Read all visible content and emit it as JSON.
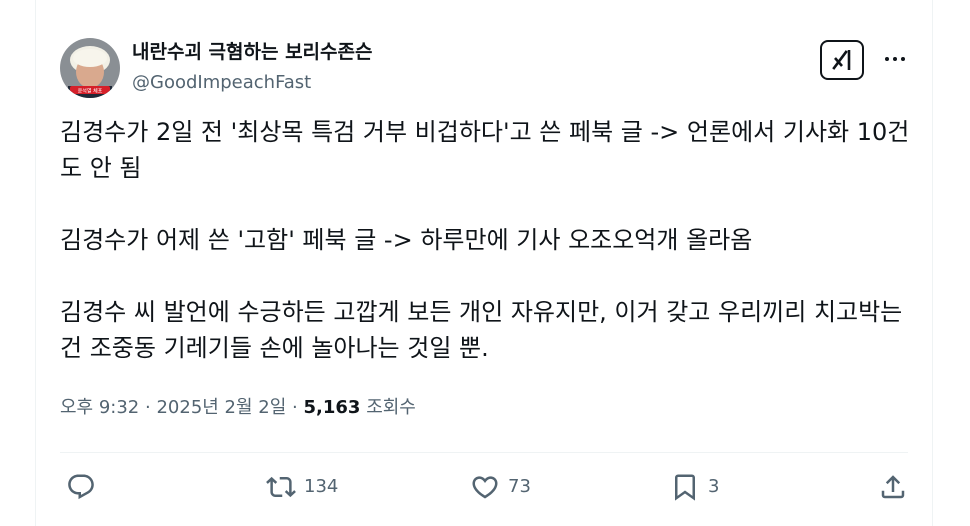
{
  "author": {
    "display_name": "내란수괴 극혐하는 보리수존슨",
    "handle": "@GoodImpeachFast",
    "avatar_badge": "윤석열 체포"
  },
  "tweet": {
    "paragraphs": [
      "김경수가 2일 전 '최상목 특검 거부 비겁하다'고 쓴 페북 글 -> 언론에서 기사화 10건 도 안 됨",
      "김경수가 어제 쓴 '고함' 페북 글 -> 하루만에 기사 오조오억개 올라옴",
      "김경수 씨 발언에 수긍하든 고깝게 보든 개인 자유지만, 이거 갖고 우리끼리 치고박는건 조중동 기레기들 손에 놀아나는 것일 뿐."
    ],
    "time": "오후 9:32",
    "separator": "·",
    "date": "2025년 2월 2일",
    "views_count": "5,163",
    "views_label": "조회수"
  },
  "actions": {
    "reply_count": "",
    "retweet_count": "134",
    "like_count": "73",
    "bookmark_count": "3"
  },
  "icons": {
    "grok": "grok-icon",
    "more": "more-icon",
    "reply": "reply-icon",
    "retweet": "retweet-icon",
    "like": "like-icon",
    "bookmark": "bookmark-icon",
    "share": "share-icon"
  },
  "colors": {
    "text": "#0f1419",
    "secondary": "#536471",
    "divider": "#eff3f4",
    "badge": "#d5202a"
  }
}
